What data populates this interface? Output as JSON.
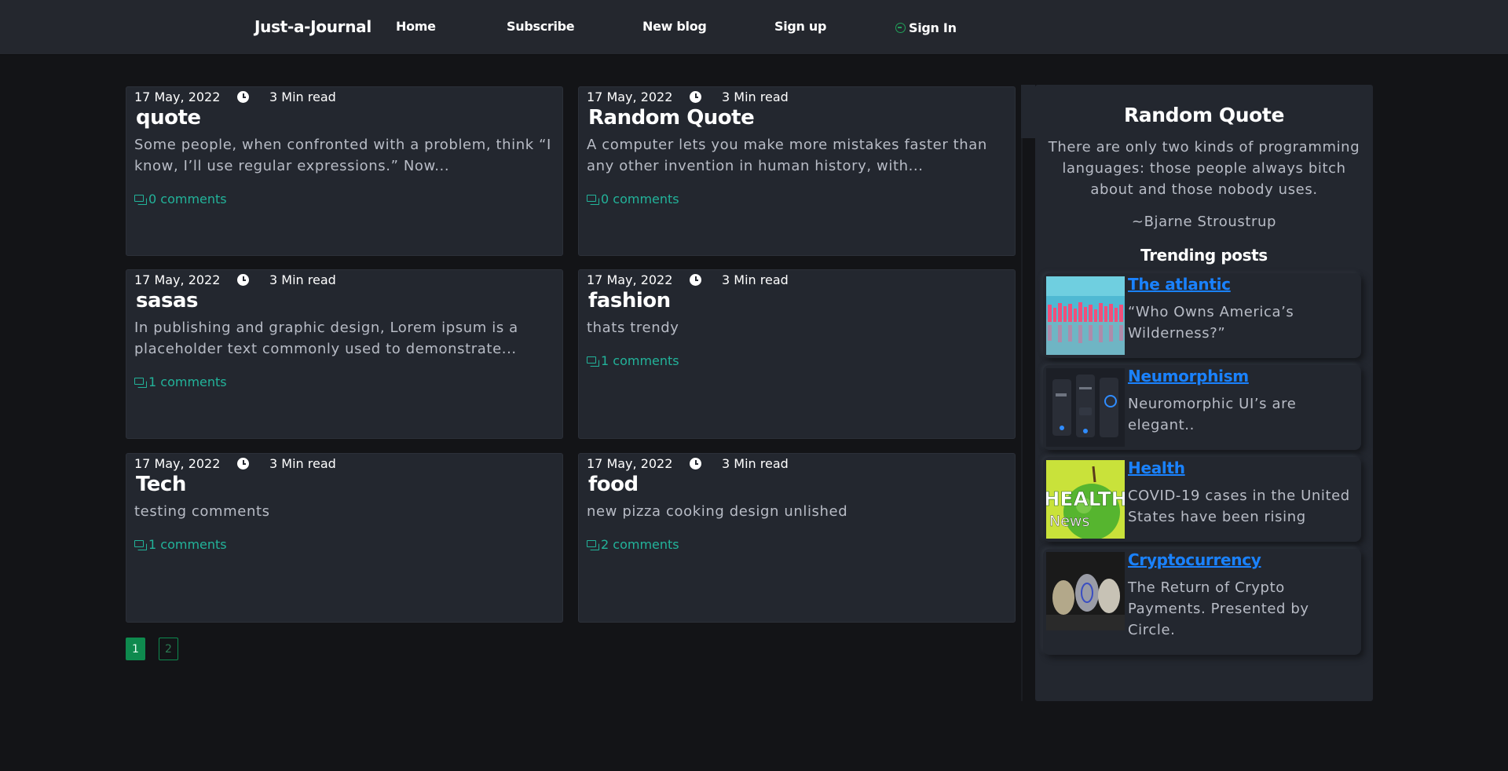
{
  "nav": {
    "brand": "Just-a-Journal",
    "links": [
      "Home",
      "Subscribe",
      "New blog",
      "Sign up"
    ],
    "signin": "Sign In"
  },
  "posts": [
    {
      "date": "17 May, 2022",
      "read_time": "3 Min read",
      "title": "quote",
      "excerpt": "Some people, when confronted with a problem, think “I know, I’ll use regular expressions.” Now...",
      "comments": "0 comments"
    },
    {
      "date": "17 May, 2022",
      "read_time": "3 Min read",
      "title": "Random Quote",
      "excerpt": "A computer lets you make more mistakes faster than any other invention in human history, with...",
      "comments": "0 comments"
    },
    {
      "date": "17 May, 2022",
      "read_time": "3 Min read",
      "title": "sasas",
      "excerpt": "In publishing and graphic design, Lorem ipsum is a placeholder text commonly used to demonstrate...",
      "comments": "1 comments"
    },
    {
      "date": "17 May, 2022",
      "read_time": "3 Min read",
      "title": "fashion",
      "excerpt": "thats trendy",
      "comments": "1 comments"
    },
    {
      "date": "17 May, 2022",
      "read_time": "3 Min read",
      "title": "Tech",
      "excerpt": "testing comments",
      "comments": "1 comments"
    },
    {
      "date": "17 May, 2022",
      "read_time": "3 Min read",
      "title": "food",
      "excerpt": "new pizza cooking design unlished",
      "comments": "2 comments"
    }
  ],
  "pagination": {
    "pages": [
      "1",
      "2"
    ],
    "current": "1"
  },
  "sidebar": {
    "title": "Random Quote",
    "quote": "There are only two kinds of programming languages: those people always bitch about and those nobody uses.",
    "author": "~Bjarne Stroustrup",
    "trending_title": "Trending posts",
    "trending": [
      {
        "title": "The atlantic",
        "desc": "“Who Owns America’s Wilderness?”"
      },
      {
        "title": "Neumorphism",
        "desc": "Neuromorphic UI’s are elegant.."
      },
      {
        "title": "Health",
        "desc": "COVID-19 cases in the United States have been rising",
        "thumb_text_1": "HEALTH",
        "thumb_text_2": "News"
      },
      {
        "title": "Cryptocurrency",
        "desc": "The Return of Crypto Payments. Presented by Circle."
      }
    ]
  },
  "colors": {
    "background": "#131417",
    "card": "#23272f",
    "accent_green": "#0e8a4e",
    "comment_teal": "#22b39a",
    "link_blue": "#1a82ff"
  },
  "icons": [
    "clock-icon",
    "comment-icon",
    "signin-icon"
  ]
}
